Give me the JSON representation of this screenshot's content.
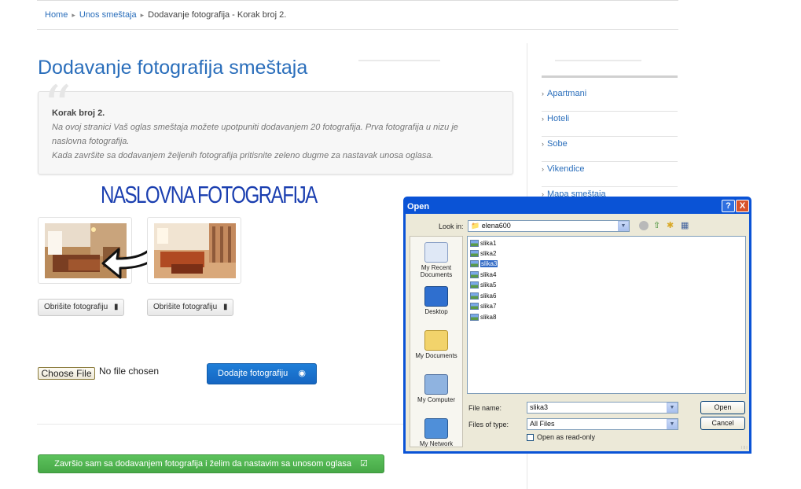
{
  "breadcrumb": {
    "home": "Home",
    "entry": "Unos smeštaja",
    "current": "Dodavanje fotografija - Korak broj 2."
  },
  "page": {
    "title": "Dodavanje fotografija smeštaja"
  },
  "info": {
    "heading": "Korak broj 2.",
    "line1": "Na ovoj stranici Vaš oglas smeštaja možete upotpuniti dodavanjem 20 fotografija. Prva fotografija u nizu je",
    "line2": "naslovna fotografija.",
    "line3": "Kada završite sa dodavanjem željenih fotografija pritisnite zeleno dugme za nastavak unosa oglasa."
  },
  "annotation": "NASLOVNA FOTOGRAFIJA",
  "photos": [
    {
      "delete_label": "Obrišite fotografiju"
    },
    {
      "delete_label": "Obrišite fotografiju"
    }
  ],
  "upload": {
    "choose_label": "Choose File",
    "no_file": "No file chosen",
    "add_label": "Dodajte fotografiju"
  },
  "finish_label": "Završio sam sa dodavanjem fotografija i želim da nastavim sa unosom oglasa",
  "sidebar": {
    "items": [
      "Apartmani",
      "Hoteli",
      "Sobe",
      "Vikendice",
      "Mapa smeštaja"
    ]
  },
  "dialog": {
    "title": "Open",
    "help_btn": "?",
    "close_btn": "X",
    "look_in_label": "Look in:",
    "look_in_value": "elena600",
    "places": [
      "My Recent Documents",
      "Desktop",
      "My Documents",
      "My Computer",
      "My Network"
    ],
    "files": [
      "slika1",
      "slika2",
      "slika3",
      "slika4",
      "slika5",
      "slika6",
      "slika7",
      "slika8"
    ],
    "selected_file": "slika3",
    "file_name_label": "File name:",
    "file_name_value": "slika3",
    "file_type_label": "Files of type:",
    "file_type_value": "All Files",
    "readonly_label": "Open as read-only",
    "open_btn": "Open",
    "cancel_btn": "Cancel"
  },
  "colors": {
    "link": "#2a6ebb",
    "primary_button": "#1566c2",
    "success_button": "#47a847",
    "annotation": "#1b3fb0",
    "dialog_title_bar": "#0a53d6"
  }
}
